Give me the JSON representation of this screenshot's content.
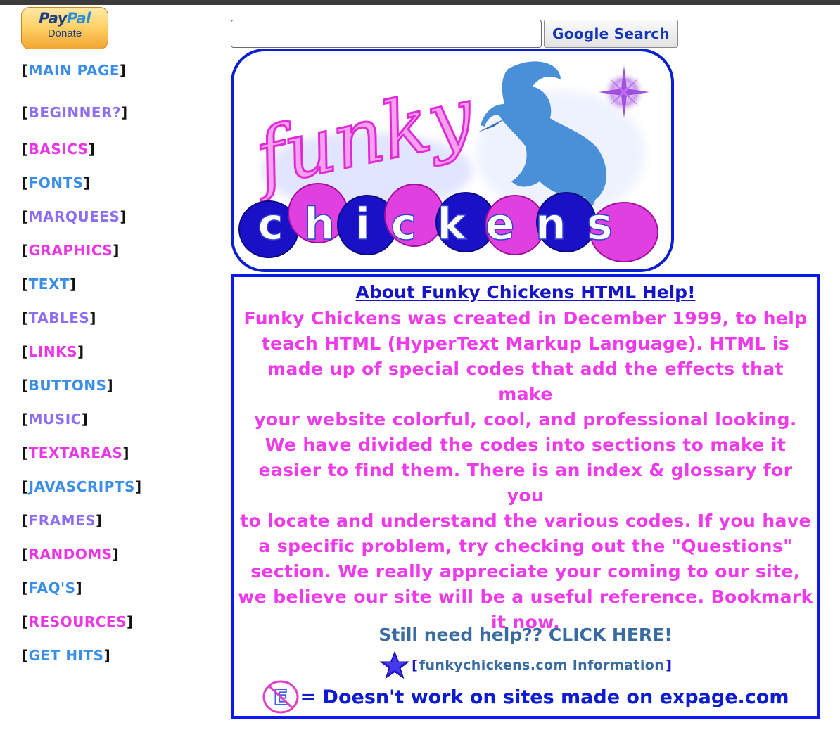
{
  "paypal": {
    "logo_pay": "Pay",
    "logo_pal": "Pal",
    "button_text": "Donate"
  },
  "search": {
    "value": "",
    "placeholder": "",
    "button_label": "Google Search"
  },
  "nav": [
    {
      "label": "MAIN PAGE",
      "color": "#3b8ee8"
    },
    {
      "label": "BEGINNER?",
      "color": "#8e6ef0"
    },
    {
      "label": "BASICS",
      "color": "#ea36e6"
    },
    {
      "label": "FONTS",
      "color": "#3b8ee8"
    },
    {
      "label": "MARQUEES",
      "color": "#8e6ef0"
    },
    {
      "label": "GRAPHICS",
      "color": "#ea36e6"
    },
    {
      "label": "TEXT",
      "color": "#3b8ee8"
    },
    {
      "label": "TABLES",
      "color": "#8e6ef0"
    },
    {
      "label": "LINKS",
      "color": "#ea36e6"
    },
    {
      "label": "BUTTONS",
      "color": "#3b8ee8"
    },
    {
      "label": "MUSIC",
      "color": "#8e6ef0"
    },
    {
      "label": "TEXTAREAS",
      "color": "#ea36e6"
    },
    {
      "label": "JAVASCRIPTS",
      "color": "#3b8ee8"
    },
    {
      "label": "FRAMES",
      "color": "#8e6ef0"
    },
    {
      "label": "RANDOMS",
      "color": "#ea36e6"
    },
    {
      "label": "FAQ'S",
      "color": "#3b8ee8"
    },
    {
      "label": "RESOURCES",
      "color": "#ea36e6"
    },
    {
      "label": "GET HITS",
      "color": "#3b8ee8"
    }
  ],
  "banner": {
    "line1": "funky",
    "line2": "chickens"
  },
  "about": {
    "title": "About Funky Chickens HTML Help!",
    "lines": [
      "Funky Chickens was created in December 1999, to help",
      "teach HTML (HyperText Markup Language). HTML is",
      "made up of special codes that add the effects that make",
      "your website colorful, cool, and professional looking.",
      "We have divided the codes into sections to make it",
      "easier to find them. There is an index & glossary for you",
      "to locate and understand the various codes. If you have",
      "a specific problem, try checking out the \"Questions\"",
      "section. We really appreciate your coming to our site,",
      "we believe our site will be a useful reference. Bookmark",
      "it now."
    ],
    "help_link": "Still need help?? CLICK HERE!",
    "info_link": "funkychickens.com Information",
    "expage_note": "= Doesn't work on sites made on expage.com"
  },
  "colors": {
    "border_blue": "#0b18f0",
    "body_pink": "#ee3aea",
    "link_steel": "#3a6ba0",
    "title_blue": "#1414c8"
  }
}
